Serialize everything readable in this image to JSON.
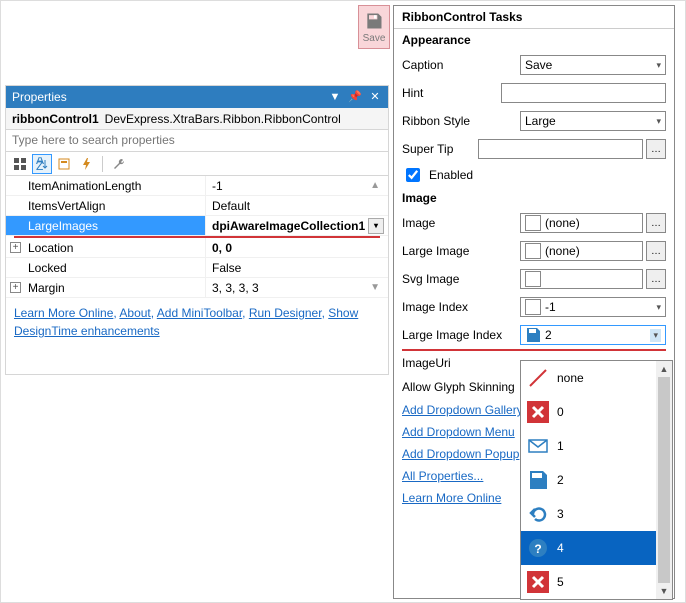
{
  "save_button": {
    "label": "Save"
  },
  "properties_panel": {
    "title": "Properties",
    "object_name": "ribbonControl1",
    "object_type": "DevExpress.XtraBars.Ribbon.RibbonControl",
    "search_placeholder": "Type here to search properties",
    "rows": {
      "itemAnimationLength": {
        "label": "ItemAnimationLength",
        "value": "-1"
      },
      "itemsVertAlign": {
        "label": "ItemsVertAlign",
        "value": "Default"
      },
      "largeImages": {
        "label": "LargeImages",
        "value": "dpiAwareImageCollection1"
      },
      "location": {
        "label": "Location",
        "value": "0, 0"
      },
      "locked": {
        "label": "Locked",
        "value": "False"
      },
      "margin": {
        "label": "Margin",
        "value": "3, 3, 3, 3"
      }
    },
    "links": {
      "learn_more": "Learn More Online",
      "about": "About",
      "add_mini": "Add MiniToolbar",
      "run_designer": "Run Designer",
      "show_dt": "Show DesignTime enhancements"
    }
  },
  "tasks_panel": {
    "title": "RibbonControl Tasks",
    "sections": {
      "appearance": "Appearance",
      "image": "Image"
    },
    "appearance": {
      "caption_label": "Caption",
      "caption_value": "Save",
      "hint_label": "Hint",
      "hint_value": "",
      "ribbon_style_label": "Ribbon Style",
      "ribbon_style_value": "Large",
      "super_tip_label": "Super Tip",
      "enabled_label": "Enabled",
      "enabled_checked": true
    },
    "image": {
      "image_label": "Image",
      "image_value": "(none)",
      "large_image_label": "Large Image",
      "large_image_value": "(none)",
      "svg_image_label": "Svg Image",
      "image_index_label": "Image Index",
      "image_index_value": "-1",
      "large_image_index_label": "Large Image Index",
      "large_image_index_value": "2",
      "image_uri_label": "ImageUri",
      "allow_glyph_label": "Allow Glyph Skinning"
    },
    "links": {
      "add_gallery": "Add Dropdown Gallery",
      "add_menu": "Add Dropdown Menu",
      "add_popup": "Add Dropdown Popup",
      "all_props": "All Properties...",
      "learn_more": "Learn More Online"
    }
  },
  "dropdown": {
    "items": [
      {
        "label": "none"
      },
      {
        "label": "0"
      },
      {
        "label": "1"
      },
      {
        "label": "2"
      },
      {
        "label": "3"
      },
      {
        "label": "4"
      },
      {
        "label": "5"
      }
    ],
    "selected_index": 5
  }
}
